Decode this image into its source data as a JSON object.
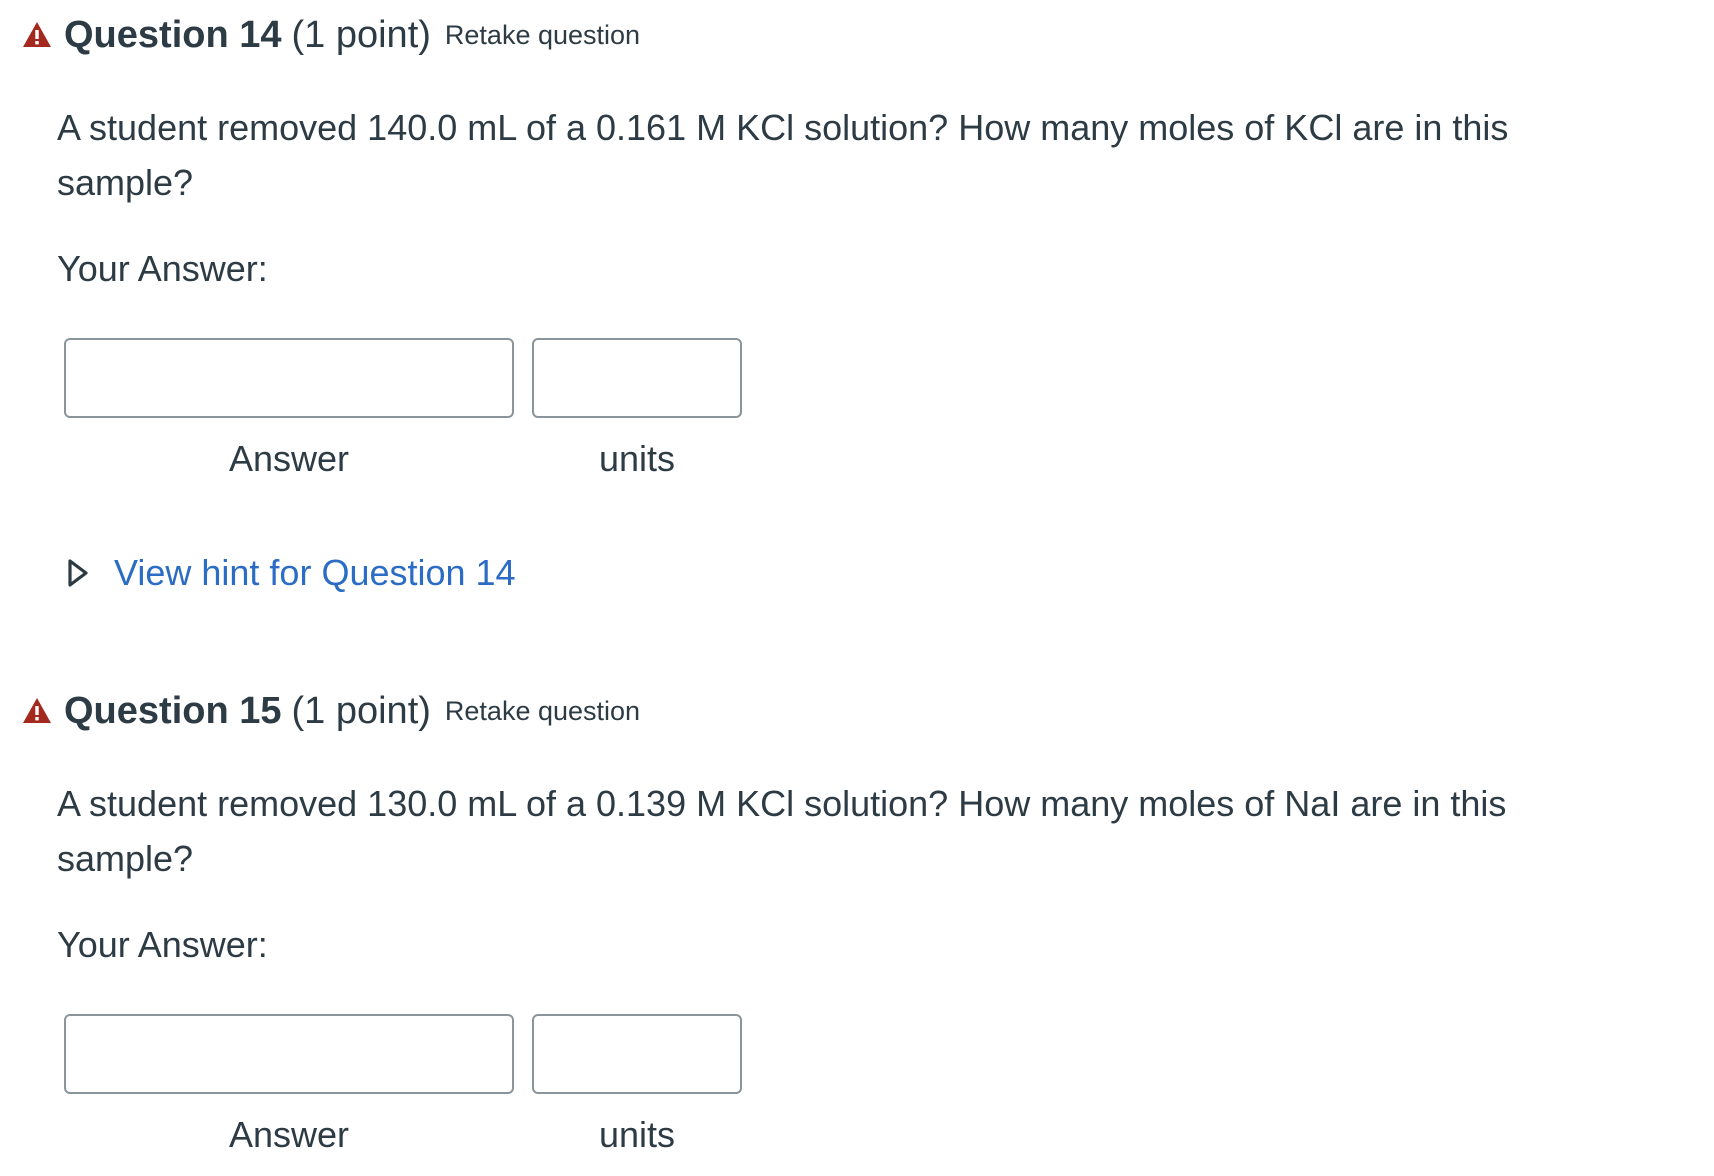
{
  "questions": [
    {
      "title": "Question 14",
      "points": "(1 point)",
      "retake_label": "Retake question",
      "text": "A student removed 140.0 mL of a 0.161 M KCl solution?  How many moles of KCl are in this sample?",
      "your_answer_label": "Your Answer:",
      "answer_value": "",
      "units_value": "",
      "answer_label": "Answer",
      "units_label": "units",
      "hint_label": "View hint for Question 14"
    },
    {
      "title": "Question 15",
      "points": "(1 point)",
      "retake_label": "Retake question",
      "text": "A student removed 130.0 mL of a 0.139 M KCl solution?  How many moles of NaI are in this sample?",
      "your_answer_label": "Your Answer:",
      "answer_value": "",
      "units_value": "",
      "answer_label": "Answer",
      "units_label": "units"
    }
  ],
  "colors": {
    "warning_icon": "#a3281e",
    "link": "#2b6cc4",
    "text": "#2d3b45",
    "input_border": "#8a949b"
  },
  "icons": {
    "warning": "warning-triangle-icon",
    "hint_toggle": "triangle-right-icon"
  }
}
